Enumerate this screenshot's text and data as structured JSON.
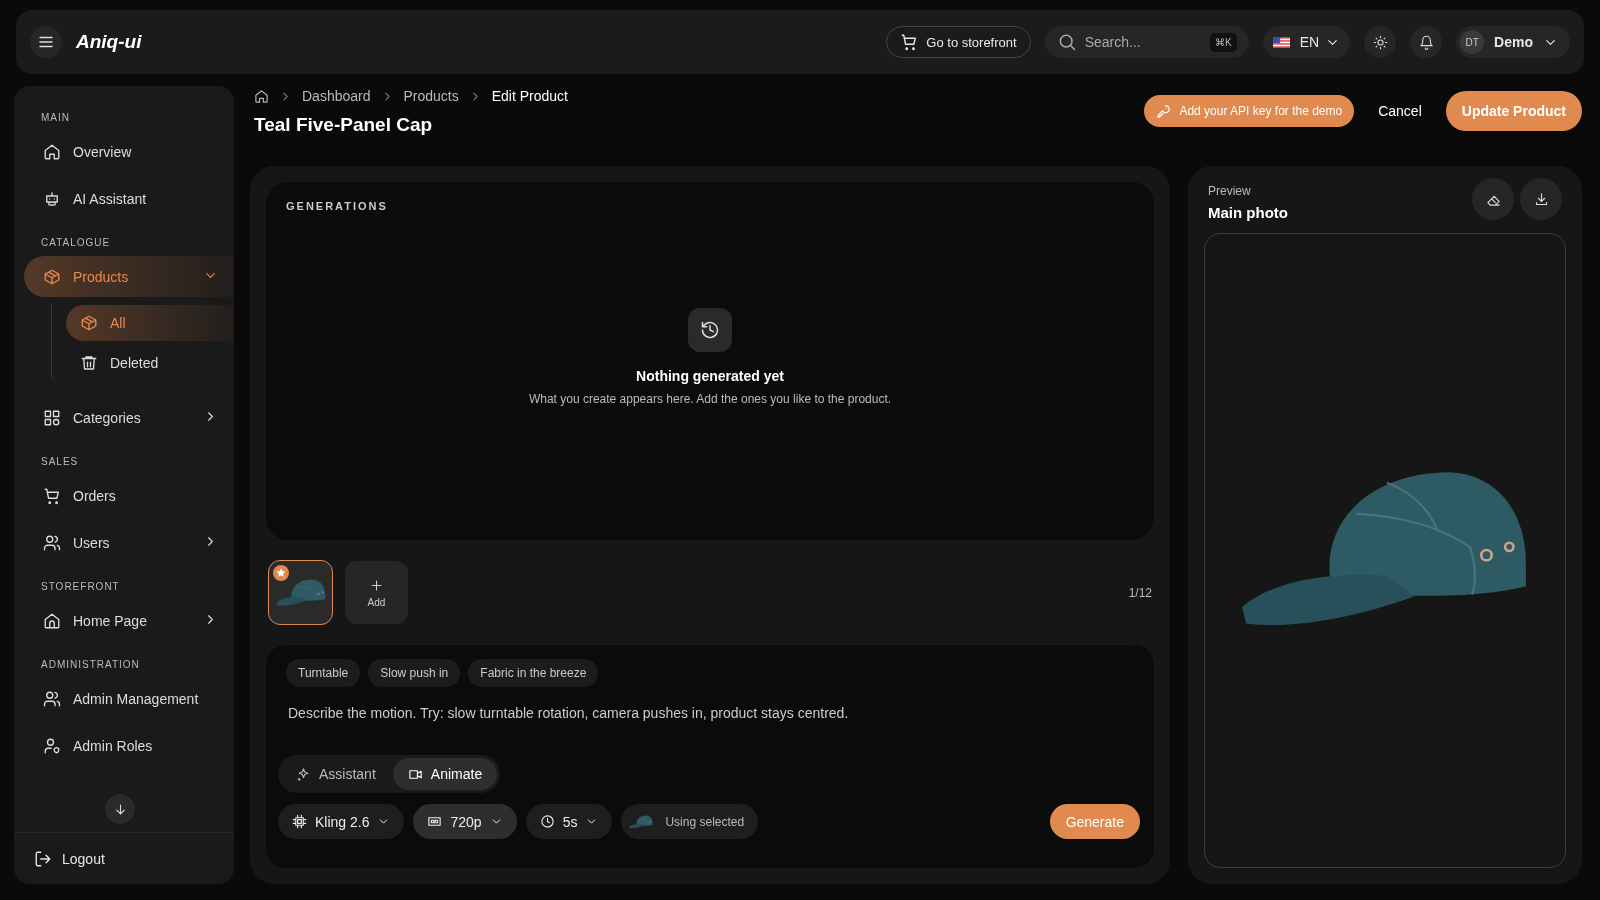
{
  "header": {
    "logo": "Aniq-ui",
    "storefront_button": "Go to storefront",
    "search": {
      "placeholder": "Search...",
      "shortcut": "⌘K"
    },
    "language": "EN",
    "user": {
      "initials": "DT",
      "name": "Demo"
    }
  },
  "sidebar": {
    "sections": [
      {
        "title": "MAIN",
        "items": [
          {
            "label": "Overview",
            "selected": false
          },
          {
            "label": "AI Assistant",
            "selected": false
          }
        ]
      },
      {
        "title": "CATALOGUE",
        "items": [
          {
            "label": "Products",
            "selected": true,
            "expanded": true,
            "children": [
              {
                "label": "All",
                "selected": true
              },
              {
                "label": "Deleted",
                "selected": false
              }
            ]
          },
          {
            "label": "Categories",
            "selected": false,
            "expanded": false
          }
        ]
      },
      {
        "title": "SALES",
        "items": [
          {
            "label": "Orders",
            "selected": false
          },
          {
            "label": "Users",
            "selected": false,
            "expanded": false
          }
        ]
      },
      {
        "title": "STOREFRONT",
        "items": [
          {
            "label": "Home Page",
            "selected": false,
            "expanded": false
          }
        ]
      },
      {
        "title": "ADMINISTRATION",
        "items": [
          {
            "label": "Admin Management",
            "selected": false
          },
          {
            "label": "Admin Roles",
            "selected": false
          }
        ]
      }
    ],
    "logout": "Logout"
  },
  "breadcrumbs": [
    "Dashboard",
    "Products",
    "Edit Product"
  ],
  "title": "Teal Five-Panel Cap",
  "actions": {
    "api_key_button": "Add your API key for the demo",
    "cancel": "Cancel",
    "update": "Update Product"
  },
  "generations": {
    "title": "GENERATIONS",
    "empty_title": "Nothing generated yet",
    "empty_text": "What you create appears here. Add the ones you like to the product.",
    "thumbnails": [
      {
        "selected": true,
        "starred": true
      }
    ],
    "add_label": "Add",
    "count": "1/12"
  },
  "prompt": {
    "suggestions": [
      "Turntable",
      "Slow push in",
      "Fabric in the breeze"
    ],
    "placeholder": "Describe the motion. Try: slow turntable rotation, camera pushes in, product stays centred.",
    "modes": [
      {
        "label": "Assistant",
        "selected": false
      },
      {
        "label": "Animate",
        "selected": true
      }
    ],
    "options": [
      {
        "label": "Kling 2.6",
        "kind": "select",
        "highlighted": false
      },
      {
        "label": "720p",
        "kind": "select",
        "highlighted": true
      },
      {
        "label": "5s",
        "kind": "select",
        "highlighted": false
      },
      {
        "label": "Using selected",
        "kind": "image",
        "highlighted": false
      }
    ],
    "generate": "Generate"
  },
  "preview": {
    "label": "Preview",
    "title": "Main photo"
  }
}
